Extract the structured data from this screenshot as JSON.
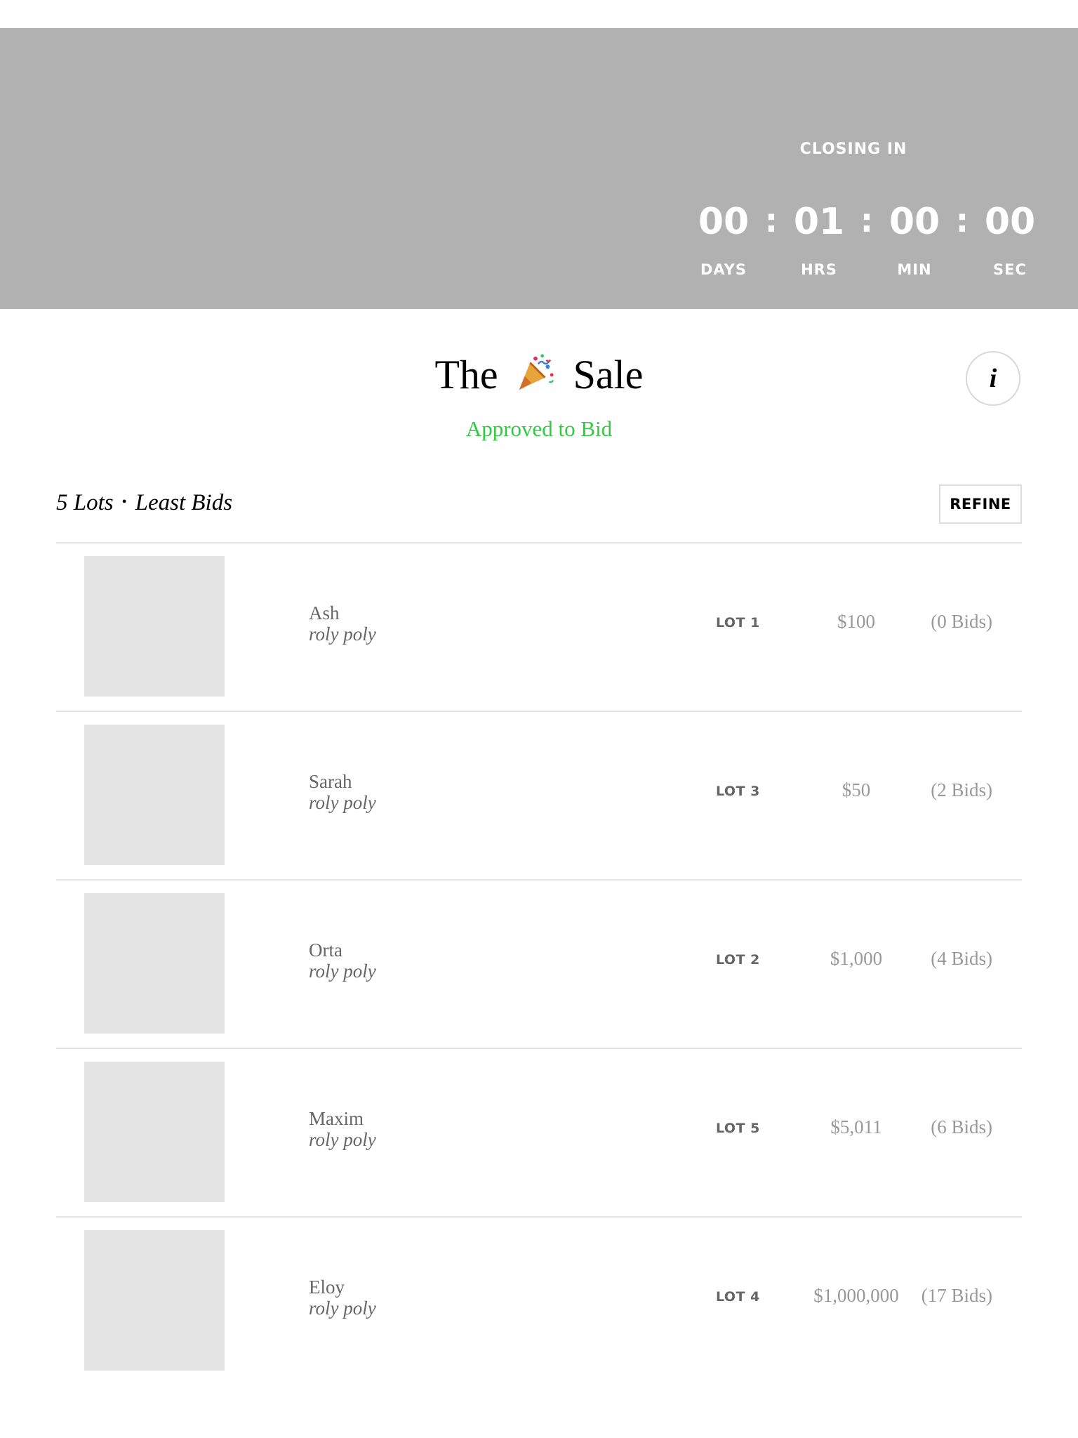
{
  "countdown": {
    "label": "CLOSING IN",
    "units": [
      {
        "value": "00",
        "label": "DAYS"
      },
      {
        "value": "01",
        "label": "HRS"
      },
      {
        "value": "00",
        "label": "MIN"
      },
      {
        "value": "00",
        "label": "SEC"
      }
    ],
    "separator": ":"
  },
  "sale": {
    "title_before": "The",
    "title_icon": "party-popper-icon",
    "title_after": "Sale",
    "status": "Approved to Bid",
    "status_color": "#2ecc40",
    "info_label": "i"
  },
  "list": {
    "lot_count": "5 Lots",
    "separator": "•",
    "sort": "Least Bids",
    "refine_label": "REFINE"
  },
  "lots": [
    {
      "artist": "Ash",
      "title": "roly poly",
      "lot": "LOT 1",
      "price": "$100",
      "bids": "(0 Bids)"
    },
    {
      "artist": "Sarah",
      "title": "roly poly",
      "lot": "LOT 3",
      "price": "$50",
      "bids": "(2 Bids)"
    },
    {
      "artist": "Orta",
      "title": "roly poly",
      "lot": "LOT 2",
      "price": "$1,000",
      "bids": "(4 Bids)"
    },
    {
      "artist": "Maxim",
      "title": "roly poly",
      "lot": "LOT 5",
      "price": "$5,011",
      "bids": "(6 Bids)"
    },
    {
      "artist": "Eloy",
      "title": "roly poly",
      "lot": "LOT 4",
      "price": "$1,000,000",
      "bids": "(17 Bids)"
    }
  ]
}
